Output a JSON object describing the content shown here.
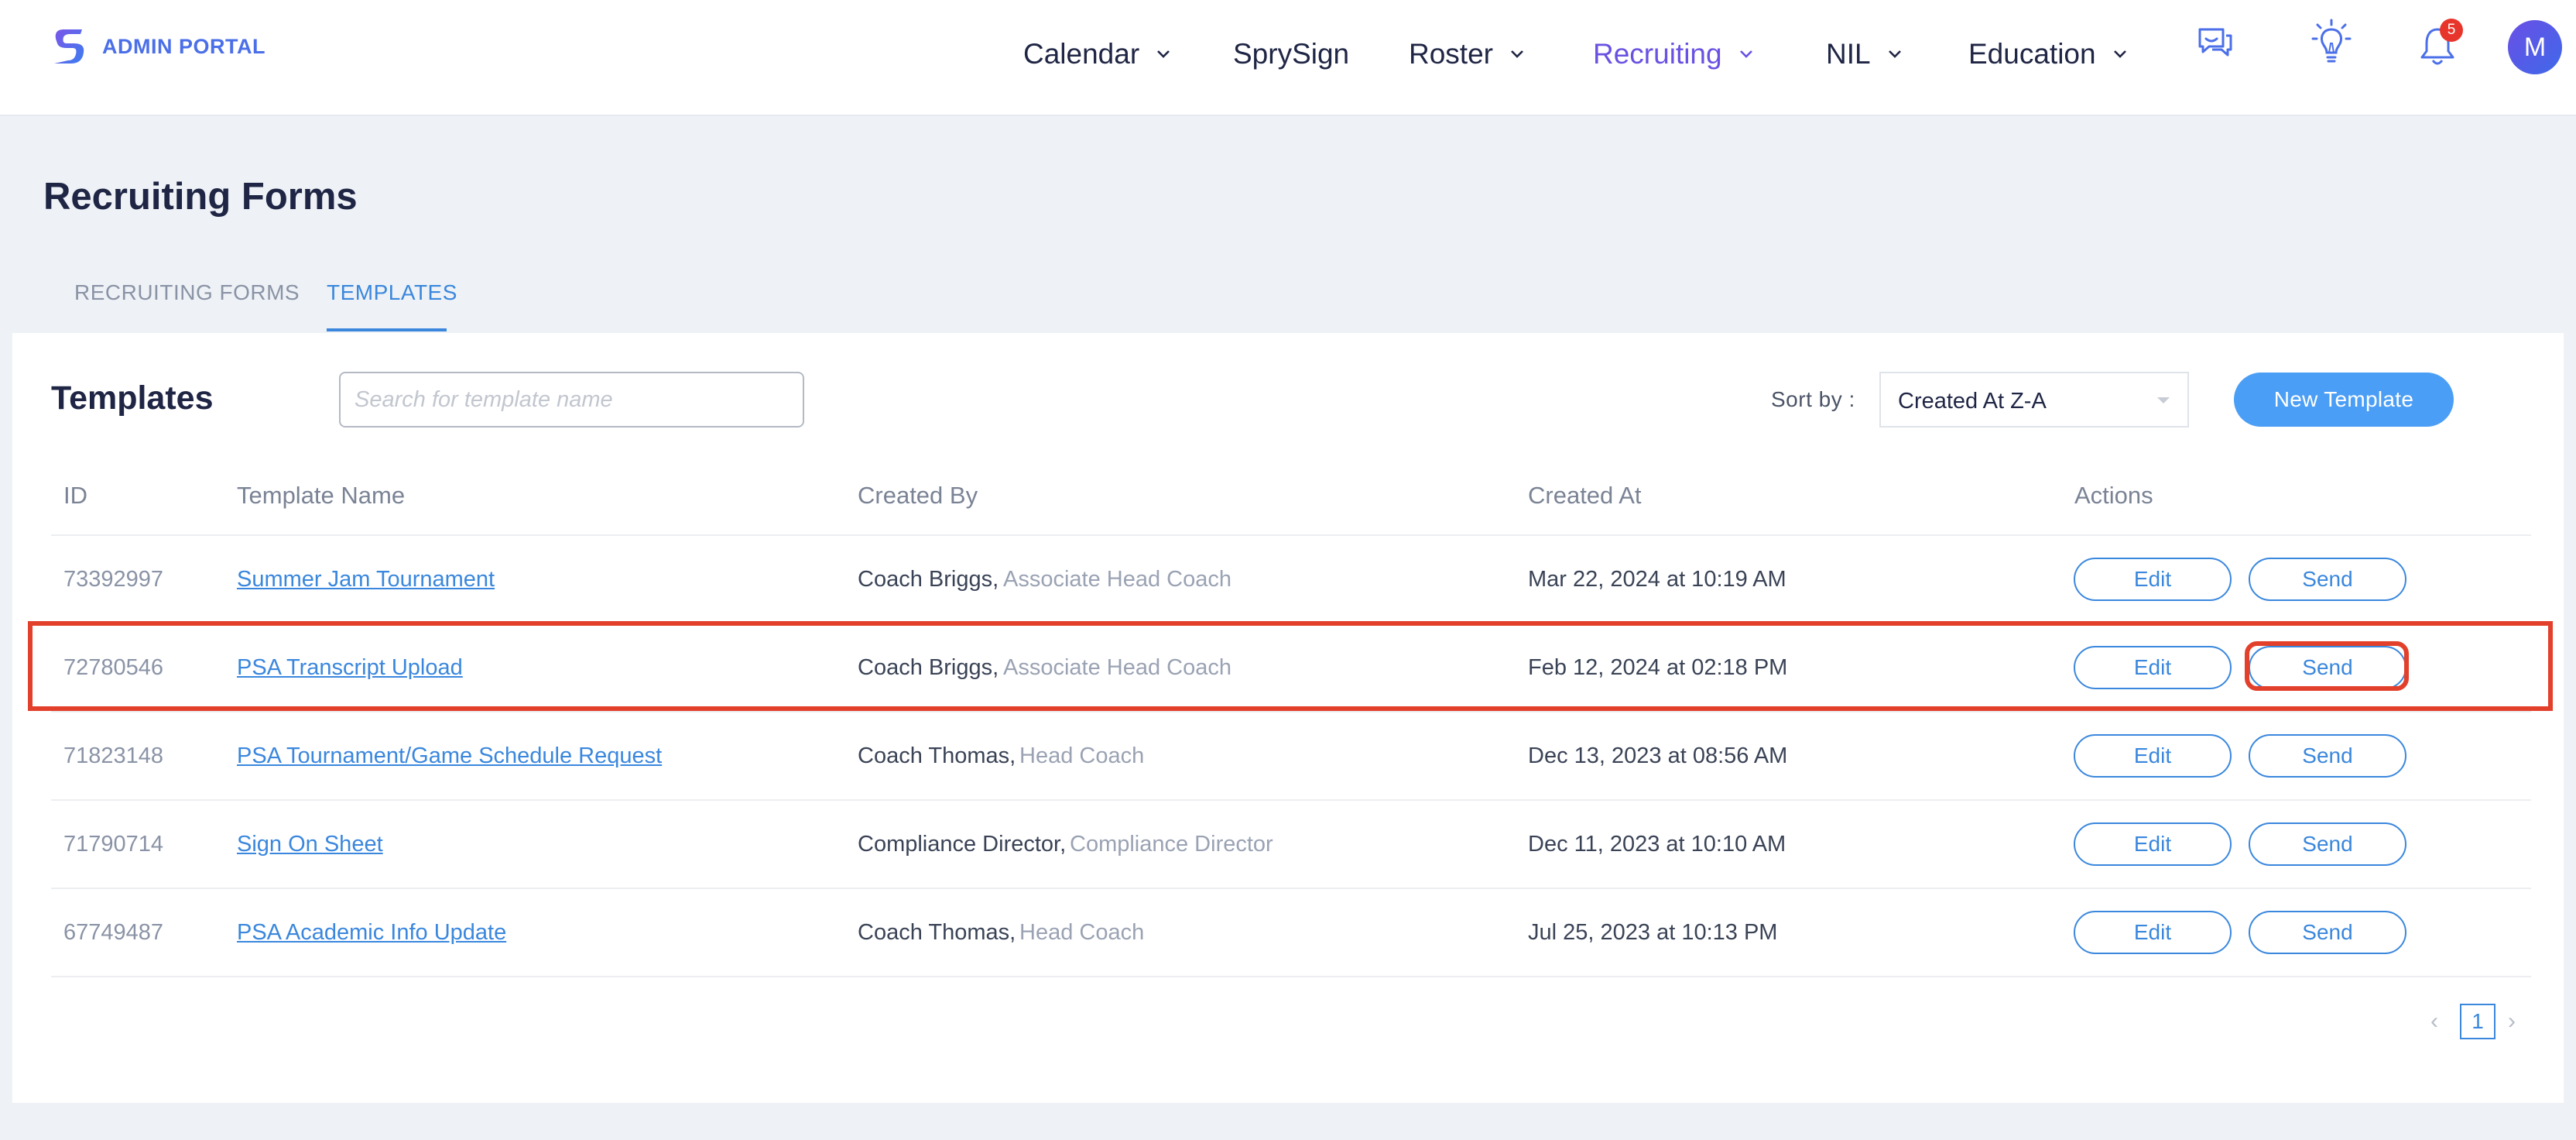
{
  "header": {
    "brand": "ADMIN PORTAL",
    "nav": [
      {
        "label": "Calendar",
        "dropdown": true
      },
      {
        "label": "SprySign",
        "dropdown": false
      },
      {
        "label": "Roster",
        "dropdown": true
      },
      {
        "label": "Recruiting",
        "dropdown": true,
        "active": true
      },
      {
        "label": "NIL",
        "dropdown": true
      },
      {
        "label": "Education",
        "dropdown": true
      }
    ],
    "icons": [
      "chat-icon",
      "lightbulb-icon",
      "bell-icon"
    ],
    "notification_count": "5",
    "avatar_initial": "M",
    "active_color": "#6a51e2"
  },
  "page": {
    "title": "Recruiting Forms",
    "tabs": [
      {
        "label": "RECRUITING FORMS",
        "active": false
      },
      {
        "label": "TEMPLATES",
        "active": true
      }
    ]
  },
  "toolbar": {
    "title": "Templates",
    "search_placeholder": "Search for template name",
    "sort_label": "Sort by :",
    "sort_value": "Created At Z-A",
    "new_button": "New Template"
  },
  "table": {
    "columns": [
      "ID",
      "Template Name",
      "Created By",
      "Created At",
      "Actions"
    ],
    "rows": [
      {
        "id": "73392997",
        "name": "Summer Jam Tournament",
        "by": "Coach Briggs,",
        "role": "Associate Head Coach",
        "date": "Mar 22, 2024 at 10:19 AM",
        "edit": "Edit",
        "send": "Send"
      },
      {
        "id": "72780546",
        "name": "PSA Transcript Upload",
        "by": "Coach Briggs,",
        "role": "Associate Head Coach",
        "date": "Feb 12, 2024 at 02:18 PM",
        "edit": "Edit",
        "send": "Send",
        "highlighted": true
      },
      {
        "id": "71823148",
        "name": "PSA Tournament/Game Schedule Request",
        "by": "Coach Thomas,",
        "role": "Head Coach",
        "date": "Dec 13, 2023 at 08:56 AM",
        "edit": "Edit",
        "send": "Send"
      },
      {
        "id": "71790714",
        "name": "Sign On Sheet",
        "by": "Compliance Director,",
        "role": "Compliance Director",
        "date": "Dec 11, 2023 at 10:10 AM",
        "edit": "Edit",
        "send": "Send"
      },
      {
        "id": "67749487",
        "name": "PSA Academic Info Update",
        "by": "Coach Thomas,",
        "role": "Head Coach",
        "date": "Jul 25, 2023 at 10:13 PM",
        "edit": "Edit",
        "send": "Send"
      }
    ]
  },
  "pagination": {
    "prev": "‹",
    "current": "1",
    "next": "›"
  },
  "colors": {
    "accent": "#3a87dd",
    "primary_button": "#4b9ef5",
    "highlight": "#e2402b"
  }
}
